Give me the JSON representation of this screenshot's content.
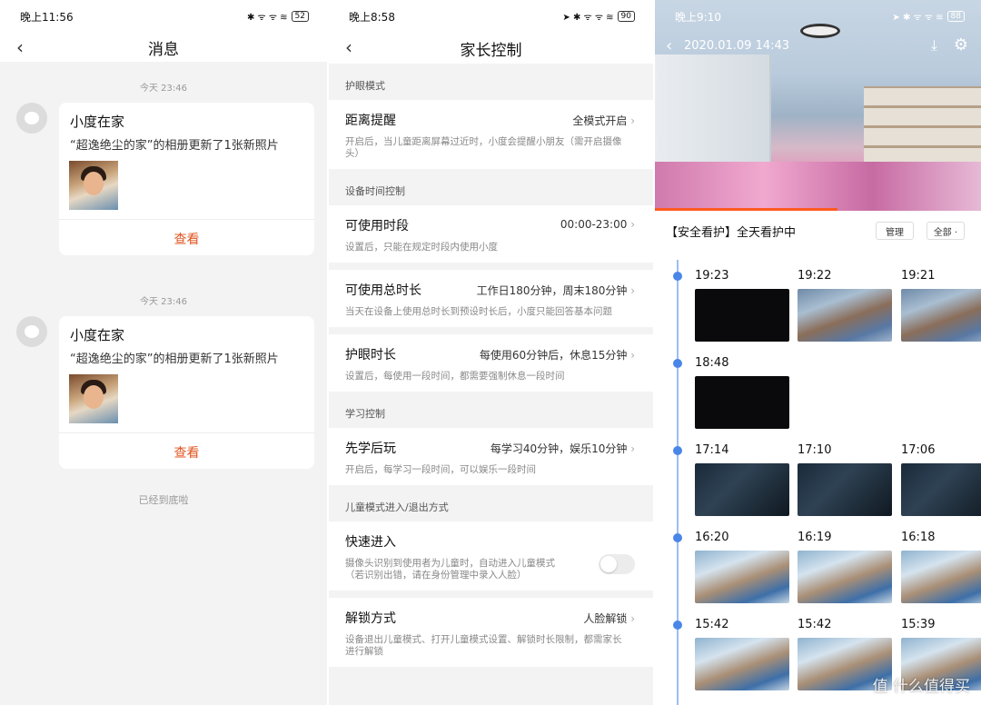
{
  "panel1": {
    "status": {
      "time": "晚上11:56",
      "icons": "✱ ᯤ ᯤ ≋",
      "battery": "52"
    },
    "title": "消息",
    "messages": [
      {
        "time": "今天 23:46",
        "title": "小度在家",
        "text": "“超逸绝尘的家”的相册更新了1张新照片",
        "action": "查看"
      },
      {
        "time": "今天 23:46",
        "title": "小度在家",
        "text": "“超逸绝尘的家”的相册更新了1张新照片",
        "action": "查看"
      }
    ],
    "end_text": "已经到底啦"
  },
  "panel2": {
    "status": {
      "time": "晚上8:58",
      "icons": "➤ ✱ ᯤ ᯤ ≋",
      "battery": "90"
    },
    "title": "家长控制",
    "sections": [
      {
        "header": "护眼模式",
        "items": [
          {
            "title": "距离提醒",
            "value": "全模式开启",
            "desc": "开启后，当儿童距离屏幕过近时，小度会提醒小朋友（需开启摄像头）"
          }
        ]
      },
      {
        "header": "设备时间控制",
        "items": [
          {
            "title": "可使用时段",
            "value": "00:00-23:00",
            "desc": "设置后，只能在规定时段内使用小度"
          },
          {
            "title": "可使用总时长",
            "value": "工作日180分钟，周末180分钟",
            "desc": "当天在设备上使用总时长到预设时长后，小度只能回答基本问题"
          },
          {
            "title": "护眼时长",
            "value": "每使用60分钟后，休息15分钟",
            "desc": "设置后，每使用一段时间，都需要强制休息一段时间"
          }
        ]
      },
      {
        "header": "学习控制",
        "items": [
          {
            "title": "先学后玩",
            "value": "每学习40分钟，娱乐10分钟",
            "desc": "开启后，每学习一段时间，可以娱乐一段时间"
          }
        ]
      },
      {
        "header": "儿童模式进入/退出方式",
        "items": [
          {
            "title": "快速进入",
            "desc": "摄像头识别到使用者为儿童时，自动进入儿童模式（若识别出错，请在身份管理中录入人脸）"
          },
          {
            "title": "解锁方式",
            "value": "人脸解锁",
            "desc": "设备退出儿童模式、打开儿童模式设置、解锁时长限制，都需家长进行解锁"
          }
        ]
      }
    ]
  },
  "panel3": {
    "status": {
      "time": "晚上9:10",
      "icons": "➤ ✱ ᯤ ᯤ ≋",
      "battery": "88"
    },
    "video_datetime": "2020.01.09 14:43",
    "video_progress": 0.56,
    "watch_title": "【安全看护】全天看护中",
    "manage_label": "管理",
    "filter_label": "全部 ·",
    "groups": [
      {
        "thumbs": [
          {
            "time": "19:23"
          },
          {
            "time": "19:22"
          },
          {
            "time": "19:21"
          }
        ]
      },
      {
        "thumbs": [
          {
            "time": "18:48"
          }
        ]
      },
      {
        "thumbs": [
          {
            "time": "17:14"
          },
          {
            "time": "17:10"
          },
          {
            "time": "17:06"
          }
        ]
      },
      {
        "thumbs": [
          {
            "time": "16:20"
          },
          {
            "time": "16:19"
          },
          {
            "time": "16:18"
          }
        ]
      },
      {
        "thumbs": [
          {
            "time": "15:42"
          },
          {
            "time": "15:42"
          },
          {
            "time": "15:39"
          }
        ]
      }
    ],
    "watermark": "值 什么值得买"
  },
  "colors": {
    "accent_orange": "#e0541f",
    "timeline_blue": "#4a86e8",
    "progress_red": "#ff5a1f"
  }
}
